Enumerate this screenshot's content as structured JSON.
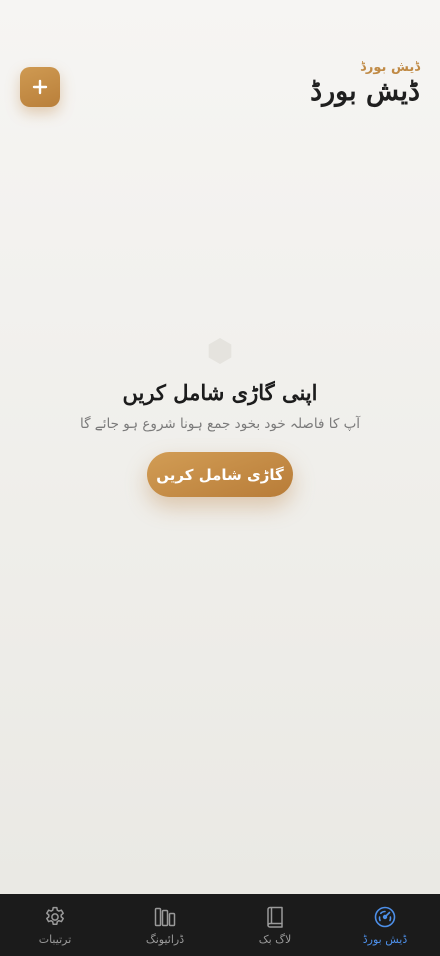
{
  "header": {
    "eyebrow": "ڈیش بورڈ",
    "title": "ڈیش بورڈ",
    "add_button_icon": "plus-icon"
  },
  "empty_state": {
    "icon": "hexagon-icon",
    "title": "اپنی گاڑی شامل کریں",
    "subtitle": "آپ کا فاصلہ خود بخود جمع ہونا شروع ہو جائے گا",
    "cta_label": "گاڑی شامل کریں"
  },
  "colors": {
    "accent": "#c08a45",
    "active_tab": "#4d8fe8",
    "nav_background": "#1b1b1b"
  },
  "bottom_nav": {
    "items": [
      {
        "label": "ترتیبات",
        "icon": "gear-icon",
        "active": false
      },
      {
        "label": "ڈرائیونگ",
        "icon": "bars-icon",
        "active": false
      },
      {
        "label": "لاگ بک",
        "icon": "book-icon",
        "active": false
      },
      {
        "label": "ڈیش بورڈ",
        "icon": "gauge-icon",
        "active": true
      }
    ]
  }
}
